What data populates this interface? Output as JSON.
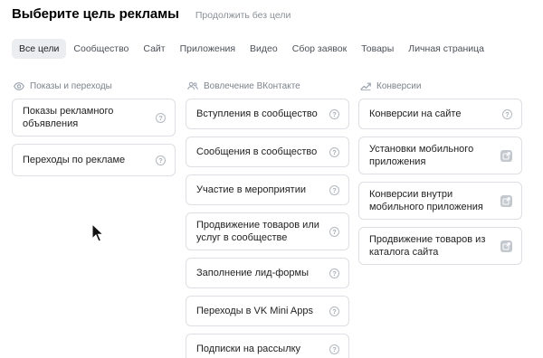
{
  "header": {
    "title": "Выберите цель рекламы",
    "skip_link": "Продолжить без цели"
  },
  "tabs": [
    {
      "label": "Все цели",
      "active": true
    },
    {
      "label": "Сообщество",
      "active": false
    },
    {
      "label": "Сайт",
      "active": false
    },
    {
      "label": "Приложения",
      "active": false
    },
    {
      "label": "Видео",
      "active": false
    },
    {
      "label": "Сбор заявок",
      "active": false
    },
    {
      "label": "Товары",
      "active": false
    },
    {
      "label": "Личная страница",
      "active": false
    }
  ],
  "columns": [
    {
      "heading": "Показы и переходы",
      "icon": "eye-icon",
      "items": [
        {
          "label": "Показы рекламного объявления",
          "icon": "help-icon"
        },
        {
          "label": "Переходы по рекламе",
          "icon": "help-icon"
        }
      ]
    },
    {
      "heading": "Вовлечение ВКонтакте",
      "icon": "users-icon",
      "items": [
        {
          "label": "Вступления в сообщество",
          "icon": "help-icon"
        },
        {
          "label": "Сообщения в сообщество",
          "icon": "help-icon"
        },
        {
          "label": "Участие в мероприятии",
          "icon": "help-icon"
        },
        {
          "label": "Продвижение товаров или услуг в сообществе",
          "icon": "help-icon"
        },
        {
          "label": "Заполнение лид-формы",
          "icon": "help-icon"
        },
        {
          "label": "Переходы в VK Mini Apps",
          "icon": "help-icon"
        },
        {
          "label": "Подписки на рассылку",
          "icon": "help-icon"
        }
      ]
    },
    {
      "heading": "Конверсии",
      "icon": "trend-up-icon",
      "items": [
        {
          "label": "Конверсии на сайте",
          "icon": "help-icon"
        },
        {
          "label": "Установки мобильного приложения",
          "icon": "external-link-icon"
        },
        {
          "label": "Конверсии внутри мобильного приложения",
          "icon": "external-link-icon"
        },
        {
          "label": "Продвижение товаров из каталога сайта",
          "icon": "external-link-icon"
        }
      ]
    }
  ],
  "help_glyph": "?"
}
